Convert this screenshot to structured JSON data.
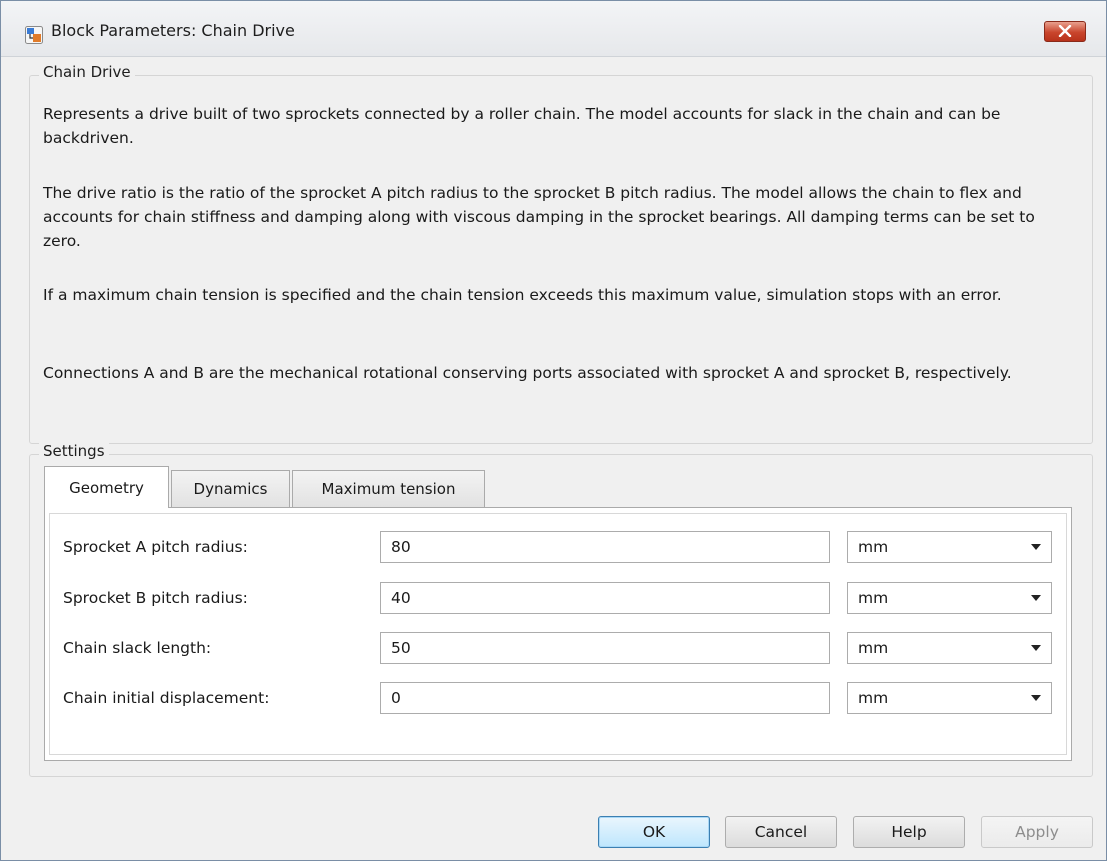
{
  "window": {
    "title": "Block Parameters: Chain Drive",
    "icon": "simulink-block-icon",
    "close_icon": "close-icon"
  },
  "description_group": {
    "legend": "Chain Drive",
    "paragraphs": [
      "Represents a drive built of two sprockets connected by a roller chain. The model accounts for slack in the chain and can be backdriven.",
      "The drive ratio is the ratio of the sprocket A pitch radius to the sprocket B pitch radius. The model allows the chain to flex and accounts for chain stiffness and damping along with viscous damping in the sprocket bearings. All damping terms can be set to zero.",
      "If a maximum chain tension is specified and the chain tension exceeds this maximum value, simulation stops with an error.",
      "Connections A and B are the mechanical rotational conserving ports associated with sprocket A and sprocket B, respectively."
    ]
  },
  "settings_group": {
    "legend": "Settings",
    "tabs": [
      {
        "label": "Geometry",
        "active": true
      },
      {
        "label": "Dynamics",
        "active": false
      },
      {
        "label": "Maximum tension",
        "active": false
      }
    ],
    "parameters": [
      {
        "label": "Sprocket A pitch radius:",
        "value": "80",
        "unit": "mm"
      },
      {
        "label": "Sprocket B pitch radius:",
        "value": "40",
        "unit": "mm"
      },
      {
        "label": "Chain slack length:",
        "value": "50",
        "unit": "mm"
      },
      {
        "label": "Chain initial displacement:",
        "value": "0",
        "unit": "mm"
      }
    ]
  },
  "buttons": {
    "ok": "OK",
    "cancel": "Cancel",
    "help": "Help",
    "apply": "Apply"
  },
  "colors": {
    "close_button": "#c9452c",
    "primary_button": "#bee6fd",
    "window_bg": "#f0f0f0"
  }
}
